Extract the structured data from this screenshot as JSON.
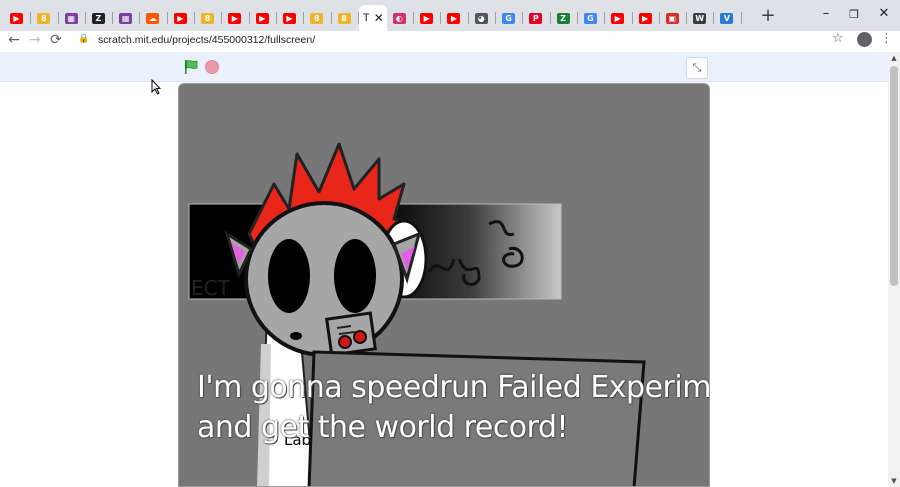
{
  "browser": {
    "tabs": [
      {
        "icon": "youtube-icon",
        "color": "#ff0000",
        "glyph": "▶"
      },
      {
        "icon": "storybook-icon",
        "color": "#f0b429",
        "glyph": "8"
      },
      {
        "icon": "purple-app-icon",
        "color": "#7b3fa0",
        "glyph": "▦"
      },
      {
        "icon": "zapier-icon",
        "color": "#222222",
        "glyph": "Z"
      },
      {
        "icon": "purple-app-icon",
        "color": "#7b3fa0",
        "glyph": "▦"
      },
      {
        "icon": "soundcloud-icon",
        "color": "#ff5500",
        "glyph": "☁"
      },
      {
        "icon": "youtube-icon",
        "color": "#ff0000",
        "glyph": "▶"
      },
      {
        "icon": "storybook-icon",
        "color": "#f0b429",
        "glyph": "8"
      },
      {
        "icon": "youtube-icon",
        "color": "#ff0000",
        "glyph": "▶"
      },
      {
        "icon": "youtube-icon",
        "color": "#ff0000",
        "glyph": "▶"
      },
      {
        "icon": "youtube-icon",
        "color": "#ff0000",
        "glyph": "▶"
      },
      {
        "icon": "storybook-icon",
        "color": "#f0b429",
        "glyph": "8"
      },
      {
        "icon": "storybook-icon",
        "color": "#f0b429",
        "glyph": "8"
      }
    ],
    "active_tab": {
      "title": "T",
      "close": "✕"
    },
    "tabs_after": [
      {
        "icon": "scratch-icon",
        "color": "#d0306a",
        "glyph": "◐"
      },
      {
        "icon": "youtube-icon",
        "color": "#ff0000",
        "glyph": "▶"
      },
      {
        "icon": "youtube-icon",
        "color": "#ff0000",
        "glyph": "▶"
      },
      {
        "icon": "chrome-icon",
        "color": "#555555",
        "glyph": "◕"
      },
      {
        "icon": "google-icon",
        "color": "#4285f4",
        "glyph": "G"
      },
      {
        "icon": "pinterest-icon",
        "color": "#e60023",
        "glyph": "P"
      },
      {
        "icon": "zapier-icon",
        "color": "#1a7f37",
        "glyph": "Z"
      },
      {
        "icon": "google-icon",
        "color": "#4285f4",
        "glyph": "G"
      },
      {
        "icon": "youtube-icon",
        "color": "#ff0000",
        "glyph": "▶"
      },
      {
        "icon": "youtube-icon",
        "color": "#ff0000",
        "glyph": "▶"
      },
      {
        "icon": "calendar-icon",
        "color": "#d93025",
        "glyph": "▣"
      },
      {
        "icon": "wordpress-icon",
        "color": "#3c3c3c",
        "glyph": "W"
      },
      {
        "icon": "vc-icon",
        "color": "#2b7bd6",
        "glyph": "V"
      }
    ],
    "new_tab": "+",
    "window": {
      "minimize": "–",
      "restore": "❐",
      "close": "✕"
    },
    "back": "←",
    "forward": "→",
    "reload": "⟳",
    "url": "scratch.mit.edu/projects/455000312/fullscreen/",
    "lock": "🔒",
    "star": "☆",
    "menu": "⋮"
  },
  "scratch": {
    "shrink_icon": "⤡",
    "speech": {
      "line1": "I'm gonna speedrun Failed Experiment",
      "line2": "and get the world record!"
    },
    "sign_text": "Lab"
  }
}
